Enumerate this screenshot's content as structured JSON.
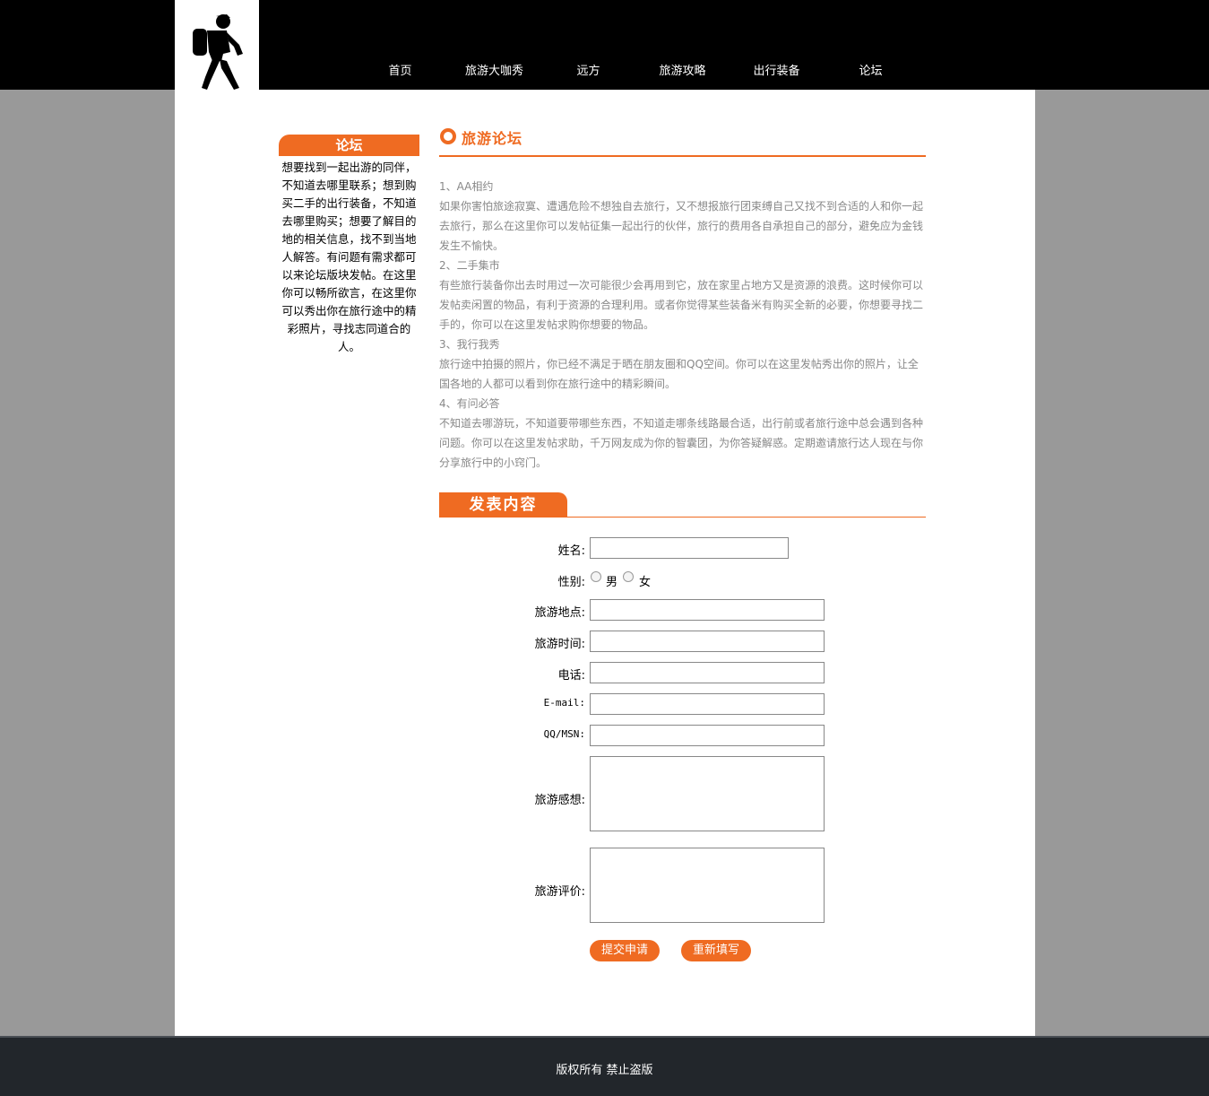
{
  "header": {
    "logo_icon": "hiker-icon",
    "nav": [
      "首页",
      "旅游大咖秀",
      "远方",
      "旅游攻略",
      "出行装备",
      "论坛"
    ]
  },
  "sidebar": {
    "title": "论坛",
    "text": "想要找到一起出游的同伴，不知道去哪里联系；想到购买二手的出行装备，不知道去哪里购买；想要了解目的地的相关信息，找不到当地人解答。有问题有需求都可以来论坛版块发帖。在这里你可以畅所欲言，在这里你可以秀出你在旅行途中的精彩照片，寻找志同道合的人。"
  },
  "section": {
    "title": "旅游论坛",
    "items": [
      "1、AA相约",
      "如果你害怕旅途寂寞、遭遇危险不想独自去旅行，又不想报旅行团束缚自己又找不到合适的人和你一起去旅行，那么在这里你可以发帖征集一起出行的伙伴，旅行的费用各自承担自己的部分，避免应为金钱发生不愉快。",
      "2、二手集市",
      "有些旅行装备你出去时用过一次可能很少会再用到它，放在家里占地方又是资源的浪费。这时候你可以发帖卖闲置的物品，有利于资源的合理利用。或者你觉得某些装备米有购买全新的必要，你想要寻找二手的，你可以在这里发帖求购你想要的物品。",
      "3、我行我秀",
      "旅行途中拍摄的照片，你已经不满足于晒在朋友圈和QQ空间。你可以在这里发帖秀出你的照片，让全国各地的人都可以看到你在旅行途中的精彩瞬间。",
      "4、有问必答",
      "不知道去哪游玩，不知道要带哪些东西，不知道走哪条线路最合适，出行前或者旅行途中总会遇到各种问题。你可以在这里发帖求助，千万网友成为你的智囊团，为你答疑解惑。定期邀请旅行达人现在与你分享旅行中的小窍门。"
    ]
  },
  "form": {
    "title": "发表内容",
    "name_label": "姓名:",
    "gender_label": "性别:",
    "gender_male": "男",
    "gender_female": "女",
    "place_label": "旅游地点:",
    "time_label": "旅游时间:",
    "phone_label": "电话:",
    "email_label": "E-mail:",
    "qq_label": "QQ/MSN:",
    "feeling_label": "旅游感想:",
    "review_label": "旅游评价:",
    "submit": "提交申请",
    "reset": "重新填写"
  },
  "footer": {
    "copyright": "版权所有 禁止盗版"
  },
  "colors": {
    "accent": "#ef6b22",
    "header_bg": "#000000",
    "page_bg": "#999999",
    "footer_bg": "#22262b"
  }
}
